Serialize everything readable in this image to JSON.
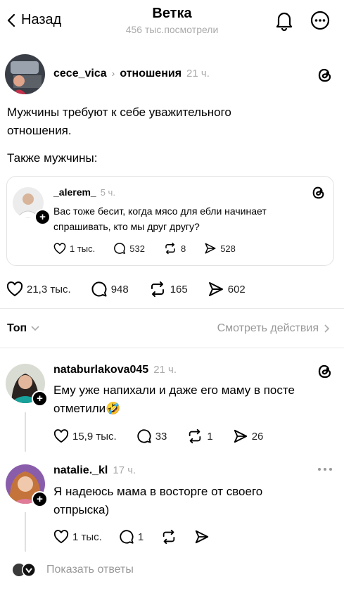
{
  "header": {
    "back_label": "Назад",
    "title": "Ветка",
    "views": "456 тыс.посмотрели"
  },
  "post": {
    "username": "cece_vica",
    "topic": "отношения",
    "time": "21 ч.",
    "text_1": "Мужчины требуют к себе уважительного отношения.",
    "text_2": "Также мужчины:",
    "quote": {
      "username": "_alerem_",
      "time": "5 ч.",
      "text": "Вас тоже бесит, когда мясо для ебли начинает спрашивать, кто мы друг другу?",
      "likes": "1 тыс.",
      "replies": "532",
      "reposts": "8",
      "shares": "528"
    },
    "likes": "21,3 тыс.",
    "replies": "948",
    "reposts": "165",
    "shares": "602"
  },
  "sort": {
    "label": "Топ",
    "activity_link": "Смотреть действия"
  },
  "comments": [
    {
      "username": "nataburlakova045",
      "time": "21 ч.",
      "text": "Ему уже напихали и даже его маму в посте отметили",
      "emoji": "🤣",
      "likes": "15,9 тыс.",
      "replies": "33",
      "reposts": "1",
      "shares": "26"
    },
    {
      "username": "natalie._kl",
      "time": "17 ч.",
      "text": "Я надеюсь мама в восторге от своего отпрыска)",
      "likes": "1 тыс.",
      "replies": "1"
    }
  ],
  "show_replies": "Показать ответы",
  "icons": [
    "chevron-left-icon",
    "bell-icon",
    "more-horizontal-icon",
    "threads-logo-icon",
    "heart-icon",
    "comment-icon",
    "repost-icon",
    "share-icon",
    "chevron-down-icon",
    "chevron-right-icon",
    "plus-icon"
  ]
}
